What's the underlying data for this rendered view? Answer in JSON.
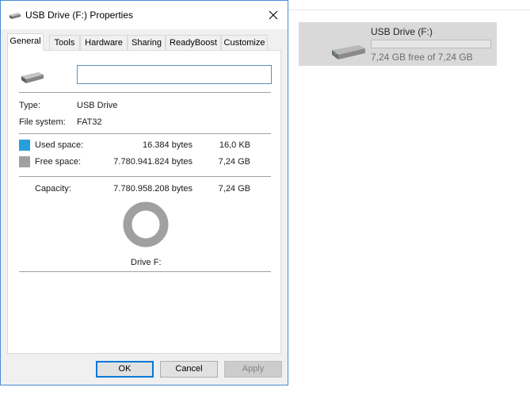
{
  "dialog": {
    "title": "USB Drive (F:) Properties",
    "icon": "usb-drive-icon",
    "tabs": [
      {
        "label": "General",
        "active": true
      },
      {
        "label": "Tools"
      },
      {
        "label": "Hardware"
      },
      {
        "label": "Sharing"
      },
      {
        "label": "ReadyBoost"
      },
      {
        "label": "Customize"
      }
    ],
    "name_field": {
      "value": ""
    },
    "type_label": "Type:",
    "type_value": "USB Drive",
    "fs_label": "File system:",
    "fs_value": "FAT32",
    "used": {
      "label": "Used space:",
      "bytes": "16.384 bytes",
      "size": "16,0 KB",
      "color": "#26a0da"
    },
    "free": {
      "label": "Free space:",
      "bytes": "7.780.941.824 bytes",
      "size": "7,24 GB",
      "color": "#a0a0a0"
    },
    "capacity": {
      "label": "Capacity:",
      "bytes": "7.780.958.208 bytes",
      "size": "7,24 GB"
    },
    "used_fraction": 2.1e-06,
    "drive_caption": "Drive F:",
    "buttons": {
      "ok": "OK",
      "cancel": "Cancel",
      "apply": "Apply"
    }
  },
  "background": {
    "drive_tile": {
      "name": "USB Drive (F:)",
      "free_text": "7,24 GB free of 7,24 GB",
      "used_fraction": 0.0,
      "icon": "usb-drive-icon"
    }
  }
}
